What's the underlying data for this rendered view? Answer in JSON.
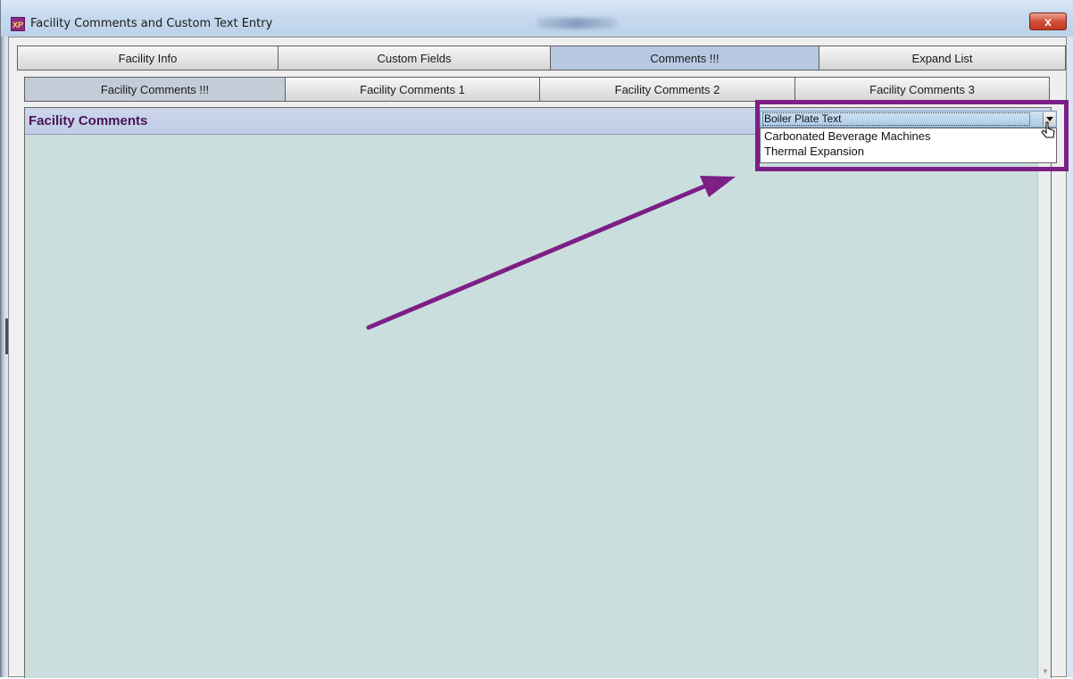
{
  "window": {
    "title": "Facility Comments and Custom Text Entry",
    "icon_text": "XP",
    "close_label": "x"
  },
  "main_tabs": [
    {
      "label": "Facility Info",
      "active": false
    },
    {
      "label": "Custom Fields",
      "active": false
    },
    {
      "label": "Comments !!!",
      "active": true
    },
    {
      "label": "Expand List",
      "active": false
    }
  ],
  "sub_tabs": [
    {
      "label": "Facility Comments !!!",
      "active": true
    },
    {
      "label": "Facility Comments 1",
      "active": false
    },
    {
      "label": "Facility Comments 2",
      "active": false
    },
    {
      "label": "Facility Comments 3",
      "active": false
    }
  ],
  "panel": {
    "title": "Facility Comments"
  },
  "boilerplate_combo": {
    "selected": "Boiler Plate Text",
    "options": [
      "Carbonated Beverage Machines",
      "Thermal Expansion"
    ]
  },
  "colors": {
    "annotation": "#7c1f86",
    "panel_bg": "#cbdede",
    "header_bg": "#c1cde6",
    "active_tab": "#b8c8e2"
  }
}
